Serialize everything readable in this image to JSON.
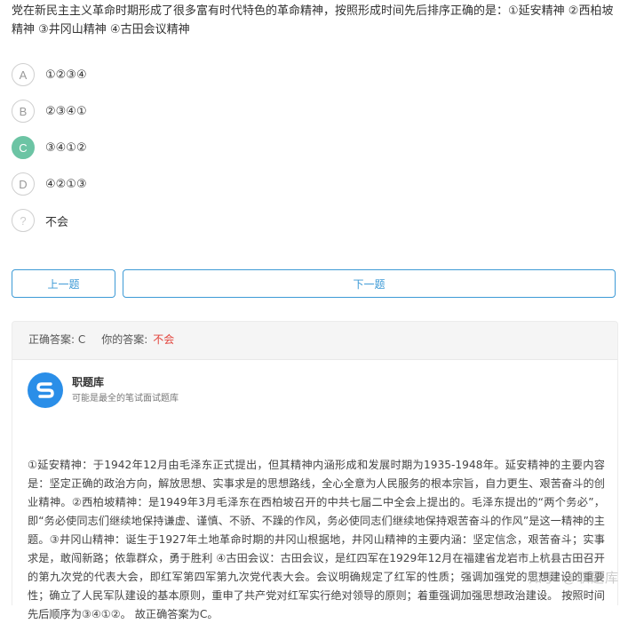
{
  "question": {
    "text": "党在新民主主义革命时期形成了很多富有时代特色的革命精神，按照形成时间先后排序正确的是：①延安精神 ②西柏坡精神 ③井冈山精神 ④古田会议精神"
  },
  "options": [
    {
      "letter": "A",
      "text": "①②③④",
      "selected": false
    },
    {
      "letter": "B",
      "text": "②③④①",
      "selected": false
    },
    {
      "letter": "C",
      "text": "③④①②",
      "selected": true
    },
    {
      "letter": "D",
      "text": "④②①③",
      "selected": false
    },
    {
      "letter": "?",
      "text": "不会",
      "selected": false
    }
  ],
  "nav": {
    "prev_label": "上一题",
    "next_label": "下一题"
  },
  "answer": {
    "correct_label": "正确答案: C",
    "yours_label": "你的答案:",
    "yours_value": "不会"
  },
  "brand": {
    "name": "职题库",
    "subtitle": "可能是最全的笔试面试题库"
  },
  "explanation": "①延安精神：于1942年12月由毛泽东正式提出，但其精神内涵形成和发展时期为1935-1948年。延安精神的主要内容是：坚定正确的政治方向，解放思想、实事求是的思想路线，全心全意为人民服务的根本宗旨，自力更生、艰苦奋斗的创业精神。②西柏坡精神：是1949年3月毛泽东在西柏坡召开的中共七届二中全会上提出的。毛泽东提出的“两个务必”，即“务必使同志们继续地保持谦虚、谨慎、不骄、不躁的作风，务必使同志们继续地保持艰苦奋斗的作风”是这一精神的主题。③井冈山精神：诞生于1927年土地革命时期的井冈山根据地，井冈山精神的主要内涵：坚定信念，艰苦奋斗；实事求是，敢闯新路；依靠群众，勇于胜利 ④古田会议：古田会议，是红四军在1929年12月在福建省龙岩市上杭县古田召开的第九次党的代表大会，即红军第四军第九次党代表大会。会议明确规定了红军的性质；强调加强党的思想建设的重要性；确立了人民军队建设的基本原则，重申了共产党对红军实行绝对领导的原则；着重强调加强思想政治建设。 按照时间先后顺序为③④①②。 故正确答案为C。",
  "watermark": "知乎 @职题库",
  "colors": {
    "accent_blue": "#3d9ad6",
    "selected_green": "#6cc4a4",
    "wrong_red": "#e2433b",
    "brand_blue": "#2a8ee8"
  }
}
